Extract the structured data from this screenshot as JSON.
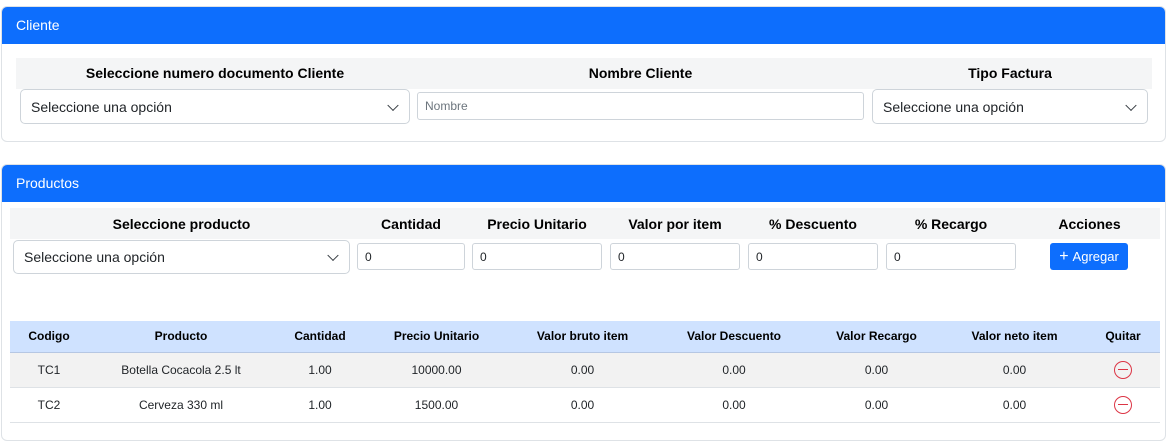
{
  "cliente": {
    "header": "Cliente",
    "labels": {
      "documento": "Seleccione numero documento Cliente",
      "nombre": "Nombre Cliente",
      "tipo": "Tipo Factura"
    },
    "documento_select": "Seleccione una opción",
    "nombre_placeholder": "Nombre",
    "tipo_select": "Seleccione una opción"
  },
  "productos": {
    "header": "Productos",
    "labels": {
      "producto": "Seleccione producto",
      "cantidad": "Cantidad",
      "precio": "Precio Unitario",
      "valor_item": "Valor por item",
      "descuento": "% Descuento",
      "recargo": "% Recargo",
      "acciones": "Acciones"
    },
    "producto_select": "Seleccione una opción",
    "cantidad_value": "0",
    "precio_value": "0",
    "valor_item_value": "0",
    "descuento_value": "0",
    "recargo_value": "0",
    "add_button": "Agregar",
    "add_icon": "plus-icon"
  },
  "table": {
    "columns": [
      "Codigo",
      "Producto",
      "Cantidad",
      "Precio Unitario",
      "Valor bruto item",
      "Valor Descuento",
      "Valor Recargo",
      "Valor neto item",
      "Quitar"
    ],
    "rows": [
      [
        "TC1",
        "Botella Cocacola 2.5 lt",
        "1.00",
        "10000.00",
        "0.00",
        "0.00",
        "0.00",
        "0.00"
      ],
      [
        "TC2",
        "Cerveza 330 ml",
        "1.00",
        "1500.00",
        "0.00",
        "0.00",
        "0.00",
        "0.00"
      ]
    ],
    "remove_icon": "minus-circle-icon"
  },
  "colors": {
    "primary": "#0d6efd",
    "table_header": "#cfe2ff",
    "danger": "#dc3545"
  }
}
